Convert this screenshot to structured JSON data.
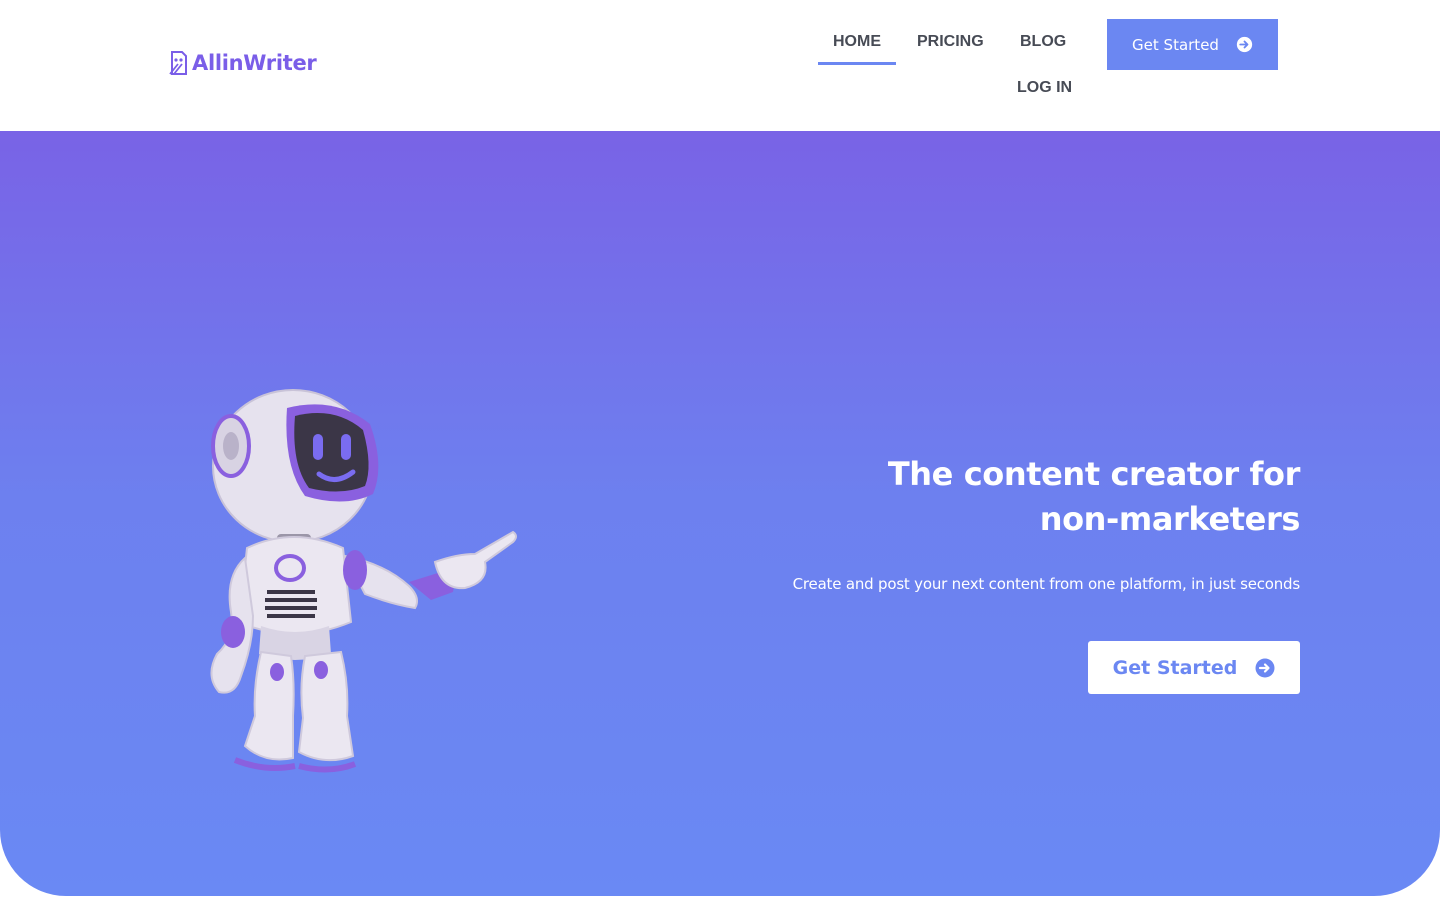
{
  "brand": {
    "name": "AllinWriter",
    "color": "#7a5ee8"
  },
  "nav": {
    "items": [
      {
        "label": "HOME",
        "active": true
      },
      {
        "label": "PRICING"
      },
      {
        "label": "BLOG"
      },
      {
        "label": "LOG IN"
      }
    ],
    "cta": {
      "label": "Get Started",
      "icon": "arrow-circle-right-icon"
    }
  },
  "hero": {
    "title_line1": "The content creator for",
    "title_line2": "non-marketers",
    "subtitle": "Create and post your next content from one platform, in just seconds",
    "cta": {
      "label": "Get Started",
      "icon": "arrow-circle-right-icon"
    },
    "illustration": "robot-pointing-illustration",
    "gradient": [
      "#7963e6",
      "#6a89f4"
    ]
  },
  "colors": {
    "accent": "#6b87f2",
    "nav_text": "#474b55"
  }
}
